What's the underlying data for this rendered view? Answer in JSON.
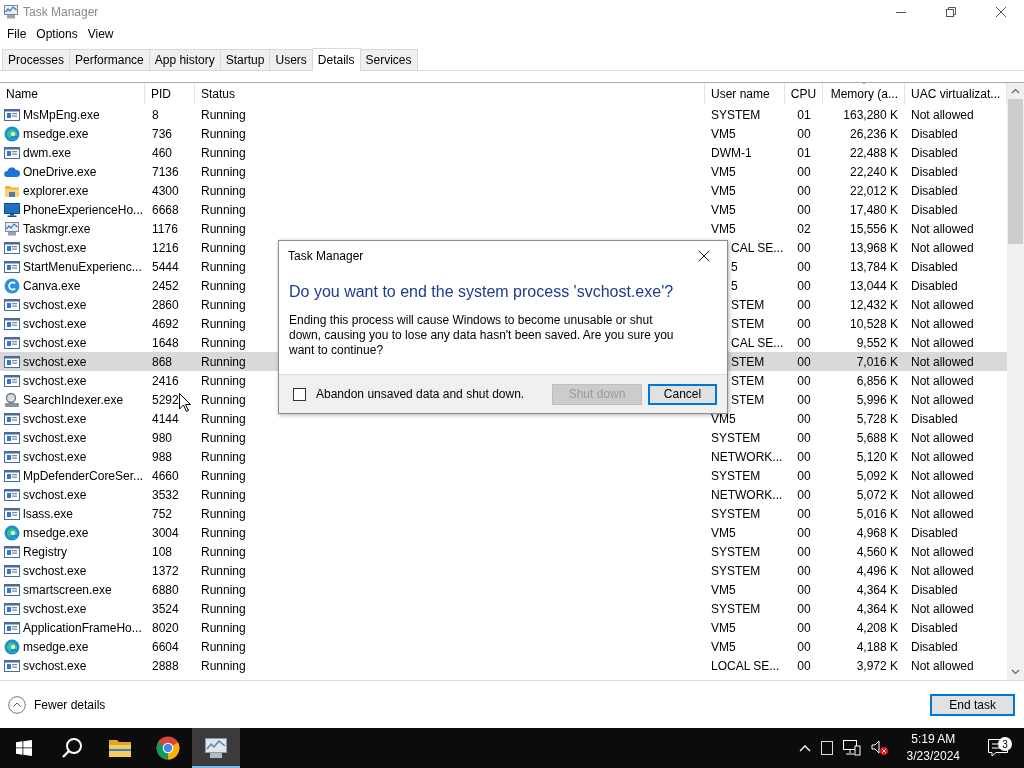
{
  "window": {
    "title": "Task Manager"
  },
  "menu": [
    "File",
    "Options",
    "View"
  ],
  "tabs": [
    {
      "label": "Processes",
      "selected": false
    },
    {
      "label": "Performance",
      "selected": false
    },
    {
      "label": "App history",
      "selected": false
    },
    {
      "label": "Startup",
      "selected": false
    },
    {
      "label": "Users",
      "selected": false
    },
    {
      "label": "Details",
      "selected": true
    },
    {
      "label": "Services",
      "selected": false
    }
  ],
  "table": {
    "columns": [
      {
        "label": "Name",
        "sorted": false
      },
      {
        "label": "PID",
        "sorted": false
      },
      {
        "label": "Status",
        "sorted": false
      },
      {
        "label": "User name",
        "sorted": false
      },
      {
        "label": "CPU",
        "sorted": false
      },
      {
        "label": "Memory (a...",
        "sorted": true
      },
      {
        "label": "UAC virtualizat...",
        "sorted": false
      }
    ],
    "rows": [
      {
        "kind": "service",
        "name": "MsMpEng.exe",
        "pid": "8",
        "status": "Running",
        "user": "SYSTEM",
        "cpu": "01",
        "memory": "163,280 K",
        "uac": "Not allowed",
        "selected": false
      },
      {
        "kind": "edge",
        "name": "msedge.exe",
        "pid": "736",
        "status": "Running",
        "user": "VM5",
        "cpu": "00",
        "memory": "26,236 K",
        "uac": "Disabled",
        "selected": false
      },
      {
        "kind": "service",
        "name": "dwm.exe",
        "pid": "460",
        "status": "Running",
        "user": "DWM-1",
        "cpu": "01",
        "memory": "22,488 K",
        "uac": "Disabled",
        "selected": false
      },
      {
        "kind": "cloud",
        "name": "OneDrive.exe",
        "pid": "7136",
        "status": "Running",
        "user": "VM5",
        "cpu": "00",
        "memory": "22,240 K",
        "uac": "Disabled",
        "selected": false
      },
      {
        "kind": "folder",
        "name": "explorer.exe",
        "pid": "4300",
        "status": "Running",
        "user": "VM5",
        "cpu": "00",
        "memory": "22,012 K",
        "uac": "Disabled",
        "selected": false
      },
      {
        "kind": "monitor",
        "name": "PhoneExperienceHo...",
        "pid": "6668",
        "status": "Running",
        "user": "VM5",
        "cpu": "00",
        "memory": "17,480 K",
        "uac": "Disabled",
        "selected": false
      },
      {
        "kind": "taskmgr",
        "name": "Taskmgr.exe",
        "pid": "1176",
        "status": "Running",
        "user": "VM5",
        "cpu": "02",
        "memory": "15,556 K",
        "uac": "Not allowed",
        "selected": false
      },
      {
        "kind": "service",
        "name": "svchost.exe",
        "pid": "1216",
        "status": "Running",
        "user": "CAL SE...",
        "cpu": "00",
        "memory": "13,968 K",
        "uac": "Not allowed",
        "selected": false
      },
      {
        "kind": "service",
        "name": "StartMenuExperienc...",
        "pid": "5444",
        "status": "Running",
        "user": "5",
        "cpu": "00",
        "memory": "13,784 K",
        "uac": "Disabled",
        "selected": false
      },
      {
        "kind": "canva",
        "name": "Canva.exe",
        "pid": "2452",
        "status": "Running",
        "user": "5",
        "cpu": "00",
        "memory": "13,044 K",
        "uac": "Disabled",
        "selected": false
      },
      {
        "kind": "service",
        "name": "svchost.exe",
        "pid": "2860",
        "status": "Running",
        "user": "STEM",
        "cpu": "00",
        "memory": "12,432 K",
        "uac": "Not allowed",
        "selected": false
      },
      {
        "kind": "service",
        "name": "svchost.exe",
        "pid": "4692",
        "status": "Running",
        "user": "STEM",
        "cpu": "00",
        "memory": "10,528 K",
        "uac": "Not allowed",
        "selected": false
      },
      {
        "kind": "service",
        "name": "svchost.exe",
        "pid": "1648",
        "status": "Running",
        "user": "CAL SE...",
        "cpu": "00",
        "memory": "9,552 K",
        "uac": "Not allowed",
        "selected": false
      },
      {
        "kind": "service",
        "name": "svchost.exe",
        "pid": "868",
        "status": "Running",
        "user": "STEM",
        "cpu": "00",
        "memory": "7,016 K",
        "uac": "Not allowed",
        "selected": true
      },
      {
        "kind": "service",
        "name": "svchost.exe",
        "pid": "2416",
        "status": "Running",
        "user": "STEM",
        "cpu": "00",
        "memory": "6,856 K",
        "uac": "Not allowed",
        "selected": false
      },
      {
        "kind": "search",
        "name": "SearchIndexer.exe",
        "pid": "5292",
        "status": "Running",
        "user": "STEM",
        "cpu": "00",
        "memory": "5,996 K",
        "uac": "Not allowed",
        "selected": false
      },
      {
        "kind": "service",
        "name": "svchost.exe",
        "pid": "4144",
        "status": "Running",
        "user": "VM5",
        "cpu": "00",
        "memory": "5,728 K",
        "uac": "Disabled",
        "selected": false
      },
      {
        "kind": "service",
        "name": "svchost.exe",
        "pid": "980",
        "status": "Running",
        "user": "SYSTEM",
        "cpu": "00",
        "memory": "5,688 K",
        "uac": "Not allowed",
        "selected": false
      },
      {
        "kind": "service",
        "name": "svchost.exe",
        "pid": "988",
        "status": "Running",
        "user": "NETWORK...",
        "cpu": "00",
        "memory": "5,120 K",
        "uac": "Not allowed",
        "selected": false
      },
      {
        "kind": "service",
        "name": "MpDefenderCoreSer...",
        "pid": "4660",
        "status": "Running",
        "user": "SYSTEM",
        "cpu": "00",
        "memory": "5,092 K",
        "uac": "Not allowed",
        "selected": false
      },
      {
        "kind": "service",
        "name": "svchost.exe",
        "pid": "3532",
        "status": "Running",
        "user": "NETWORK...",
        "cpu": "00",
        "memory": "5,072 K",
        "uac": "Not allowed",
        "selected": false
      },
      {
        "kind": "service",
        "name": "lsass.exe",
        "pid": "752",
        "status": "Running",
        "user": "SYSTEM",
        "cpu": "00",
        "memory": "5,016 K",
        "uac": "Not allowed",
        "selected": false
      },
      {
        "kind": "edge",
        "name": "msedge.exe",
        "pid": "3004",
        "status": "Running",
        "user": "VM5",
        "cpu": "00",
        "memory": "4,968 K",
        "uac": "Disabled",
        "selected": false
      },
      {
        "kind": "service",
        "name": "Registry",
        "pid": "108",
        "status": "Running",
        "user": "SYSTEM",
        "cpu": "00",
        "memory": "4,560 K",
        "uac": "Not allowed",
        "selected": false
      },
      {
        "kind": "service",
        "name": "svchost.exe",
        "pid": "1372",
        "status": "Running",
        "user": "SYSTEM",
        "cpu": "00",
        "memory": "4,496 K",
        "uac": "Not allowed",
        "selected": false
      },
      {
        "kind": "service",
        "name": "smartscreen.exe",
        "pid": "6880",
        "status": "Running",
        "user": "VM5",
        "cpu": "00",
        "memory": "4,364 K",
        "uac": "Disabled",
        "selected": false
      },
      {
        "kind": "service",
        "name": "svchost.exe",
        "pid": "3524",
        "status": "Running",
        "user": "SYSTEM",
        "cpu": "00",
        "memory": "4,364 K",
        "uac": "Not allowed",
        "selected": false
      },
      {
        "kind": "service",
        "name": "ApplicationFrameHo...",
        "pid": "8020",
        "status": "Running",
        "user": "VM5",
        "cpu": "00",
        "memory": "4,208 K",
        "uac": "Disabled",
        "selected": false
      },
      {
        "kind": "edge",
        "name": "msedge.exe",
        "pid": "6604",
        "status": "Running",
        "user": "VM5",
        "cpu": "00",
        "memory": "4,188 K",
        "uac": "Disabled",
        "selected": false
      },
      {
        "kind": "service",
        "name": "svchost.exe",
        "pid": "2888",
        "status": "Running",
        "user": "LOCAL SE...",
        "cpu": "00",
        "memory": "3,972 K",
        "uac": "Not allowed",
        "selected": false
      }
    ]
  },
  "footer": {
    "toggle": "Fewer details",
    "button": "End task"
  },
  "dialog": {
    "title": "Task Manager",
    "heading": "Do you want to end the system process 'svchost.exe'?",
    "message": "Ending this process will cause Windows to become unusable or shut down, causing you to lose any data hasn't been saved. Are you sure you want to continue?",
    "checkbox": {
      "label": "Abandon unsaved data and shut down.",
      "checked": false
    },
    "buttons": [
      {
        "label": "Shut down",
        "disabled": true,
        "focused": false
      },
      {
        "label": "Cancel",
        "disabled": false,
        "focused": true
      }
    ]
  },
  "taskbar": {
    "apps": [
      {
        "kind": "folder",
        "active": false
      },
      {
        "kind": "chrome",
        "active": false
      },
      {
        "kind": "taskmgr",
        "active": true
      }
    ],
    "time": "5:19 AM",
    "date": "3/23/2024",
    "notifications": "3"
  }
}
